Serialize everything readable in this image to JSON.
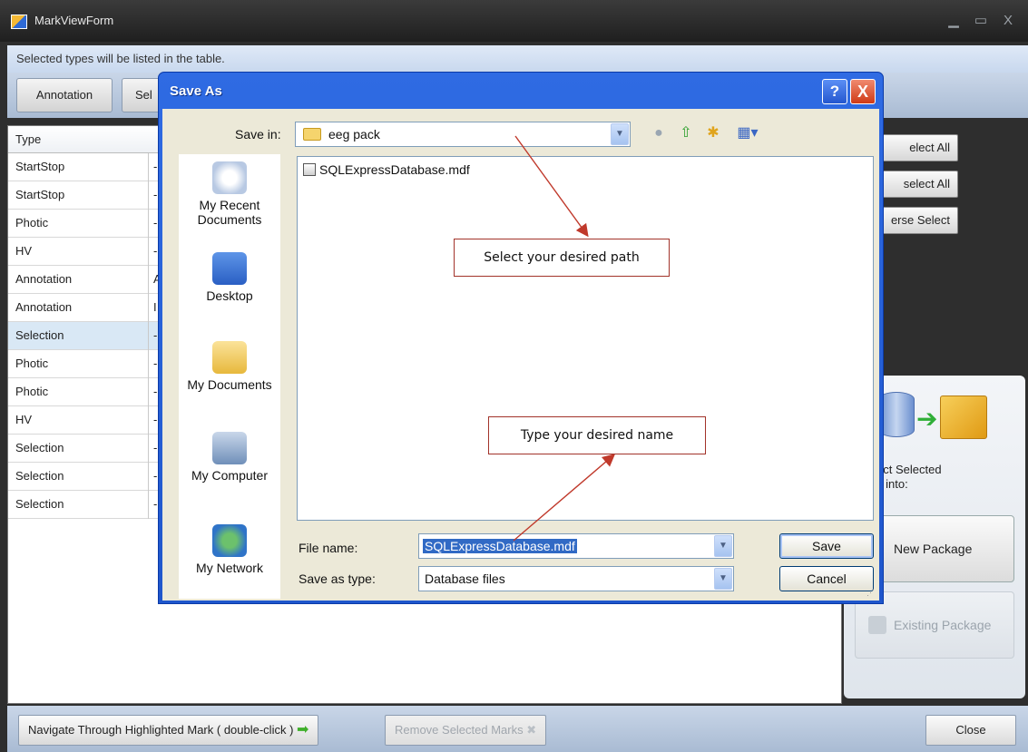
{
  "main": {
    "title": "MarkViewForm",
    "hint": "Selected types will be listed in the table.",
    "filter_buttons": [
      "Annotation",
      "Sel"
    ],
    "grid": {
      "header_type": "Type",
      "rows": [
        {
          "type": "StartStop",
          "col2": "-"
        },
        {
          "type": "StartStop",
          "col2": "-"
        },
        {
          "type": "Photic",
          "col2": "-"
        },
        {
          "type": "HV",
          "col2": "-"
        },
        {
          "type": "Annotation",
          "col2": "A"
        },
        {
          "type": "Annotation",
          "col2": "I"
        },
        {
          "type": "Selection",
          "col2": "-"
        },
        {
          "type": "Photic",
          "col2": "-"
        },
        {
          "type": "Photic",
          "col2": "-"
        },
        {
          "type": "HV",
          "col2": "-"
        },
        {
          "type": "Selection",
          "col2": "-"
        },
        {
          "type": "Selection",
          "col2": "-"
        },
        {
          "type": "Selection",
          "col2": "-"
        }
      ]
    },
    "right_buttons": [
      "elect All",
      "select All",
      "erse Select"
    ],
    "extract_label": "act Selected\ns into:",
    "new_package": "New Package",
    "existing_package": "Existing Package",
    "bottom": {
      "navigate": "Navigate Through Highlighted Mark ( double-click )",
      "remove": "Remove Selected Marks",
      "close": "Close"
    }
  },
  "dialog": {
    "title": "Save As",
    "help_glyph": "?",
    "close_glyph": "X",
    "save_in_label": "Save in:",
    "save_in_value": "eeg pack",
    "places": [
      "My Recent Documents",
      "Desktop",
      "My Documents",
      "My Computer",
      "My Network"
    ],
    "files": [
      "SQLExpressDatabase.mdf"
    ],
    "file_name_label": "File name:",
    "file_name_value": "SQLExpressDatabase.mdf",
    "save_as_type_label": "Save as type:",
    "save_as_type_value": "Database files",
    "save_button": "Save",
    "cancel_button": "Cancel"
  },
  "annotations": {
    "path_callout": "Select your desired path",
    "name_callout": "Type your desired name"
  },
  "colors": {
    "dialog_title_blue": "#2f6be3",
    "annotation_red": "#c0392b",
    "selection_blue": "#316ac5"
  }
}
